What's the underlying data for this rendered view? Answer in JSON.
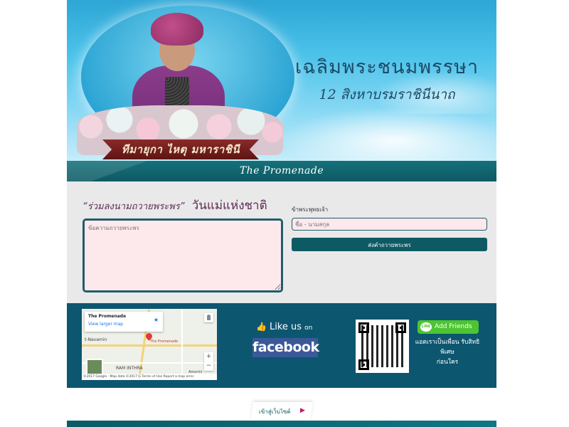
{
  "banner": {
    "title": "เฉลิมพระชนมพรรษา",
    "subtitle": "12 สิงหาบรมราชินีนาถ",
    "ribbon_text": "ทีมายุกา ไหตุ มหาราชินี"
  },
  "brand": {
    "logo_text": "The Promenade"
  },
  "form": {
    "heading_quote": "“ร่วมลงนามถวายพระพร”",
    "heading_emphasis": "วันแม่แห่งชาติ",
    "wish_placeholder": "ข้อความถวายพระพร",
    "name_label": "ข้าพระพุทธเจ้า",
    "name_placeholder": "ชื่อ - นามสกุล",
    "submit_label": "ส่งคำถวายพระพร"
  },
  "map": {
    "place_name": "The Promenade",
    "view_larger": "View larger map",
    "pin_label": "The Promenade",
    "area_label_1": "t-Navamin",
    "area_label_2": "RAM INTHRA",
    "area_label_3": "Amorini",
    "zoom_in": "+",
    "zoom_out": "−",
    "footer": "©2017 Google · Map data ©2017 G  Terms of Use   Report a map error"
  },
  "facebook": {
    "like_text": "Like us",
    "on_text": "on",
    "logo_text": "facebook"
  },
  "line": {
    "icon_text": "LINE",
    "add_friends_label": "Add Friends",
    "promo_line1": "แอดเราเป็นเพื่อน รับสิทธิพิเศษ",
    "promo_line2": "ก่อนใคร"
  },
  "footer": {
    "enter_site_label": "เข้าสู่เว็บไซต์",
    "enter_arrow": "▶"
  },
  "colors": {
    "brand_teal": "#0e5a64",
    "info_bg": "#0d5670",
    "facebook_blue": "#3b5998",
    "line_green": "#4cc531",
    "accent_purple": "#5f2a55"
  }
}
